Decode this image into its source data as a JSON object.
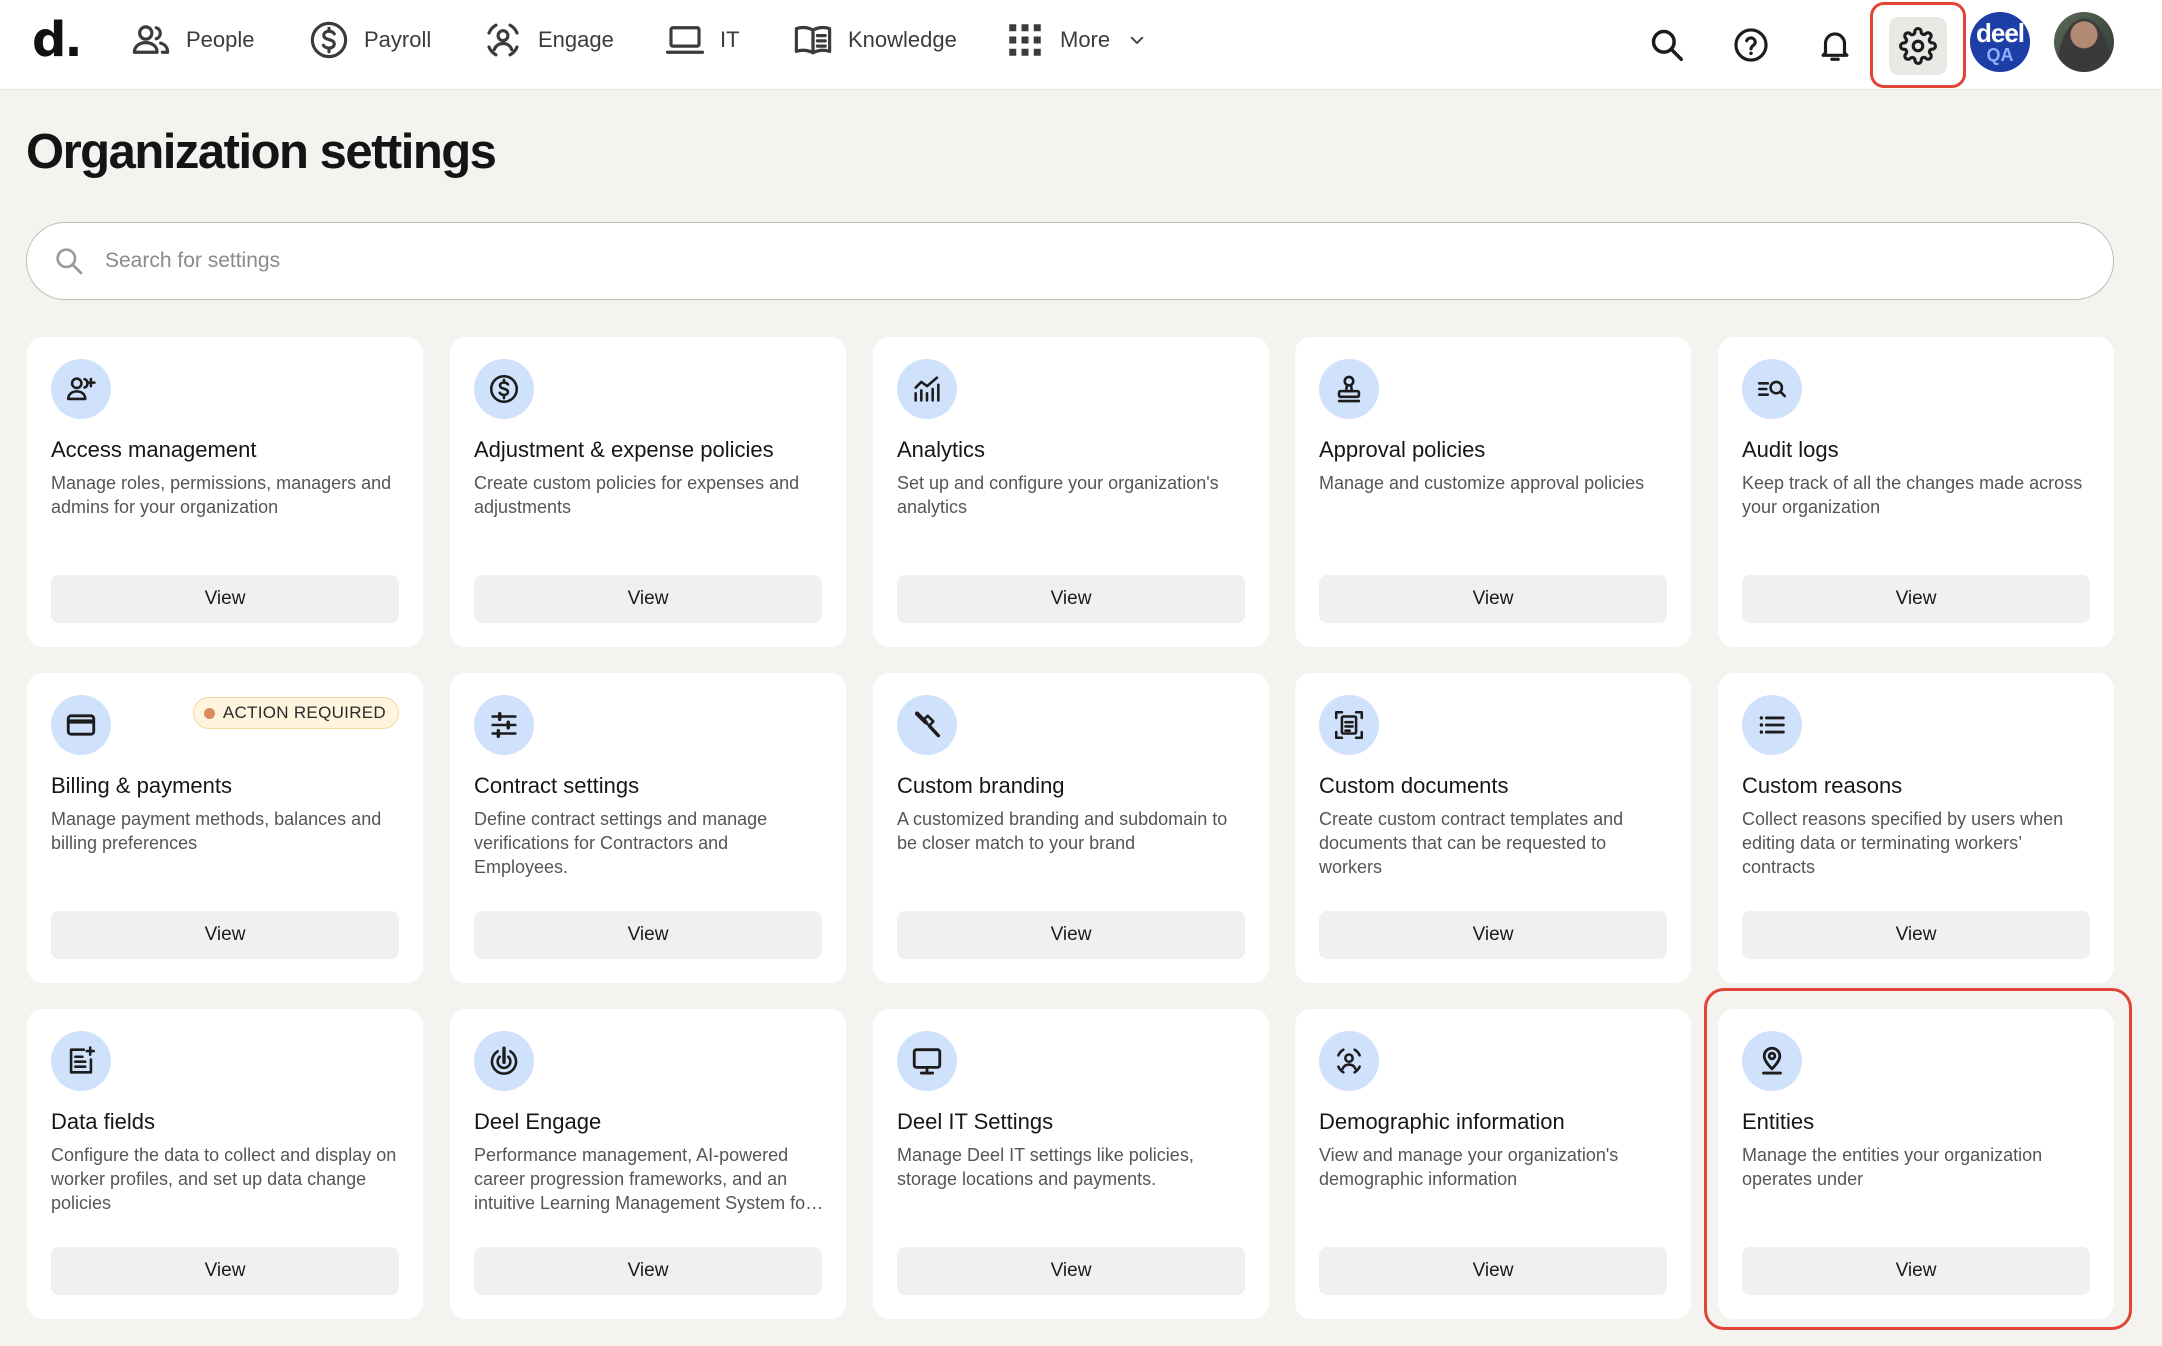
{
  "nav": {
    "logo": "d.",
    "items": [
      {
        "label": "People",
        "icon": "people-icon"
      },
      {
        "label": "Payroll",
        "icon": "dollar-circle-icon"
      },
      {
        "label": "Engage",
        "icon": "engage-icon"
      },
      {
        "label": "IT",
        "icon": "laptop-icon"
      },
      {
        "label": "Knowledge",
        "icon": "book-icon"
      },
      {
        "label": "More",
        "icon": "grid-icon"
      }
    ],
    "org_avatar": {
      "line1": "deel",
      "line2": "QA"
    }
  },
  "page": {
    "title": "Organization settings",
    "search_placeholder": "Search for settings"
  },
  "cards": [
    {
      "title": "Access management",
      "desc": "Manage roles, permissions, managers and admins for your organization",
      "button": "View",
      "icon": "user-add-icon"
    },
    {
      "title": "Adjustment & expense policies",
      "desc": "Create custom policies for expenses and adjustments",
      "button": "View",
      "icon": "dollar-circle-icon"
    },
    {
      "title": "Analytics",
      "desc": "Set up and configure your organization's analytics",
      "button": "View",
      "icon": "analytics-icon"
    },
    {
      "title": "Approval policies",
      "desc": "Manage and customize approval policies",
      "button": "View",
      "icon": "stamp-icon"
    },
    {
      "title": "Audit logs",
      "desc": "Keep track of all the changes made across your organization",
      "button": "View",
      "icon": "log-search-icon"
    },
    {
      "title": "Billing & payments",
      "desc": "Manage payment methods, balances and billing preferences",
      "button": "View",
      "icon": "credit-card-icon",
      "badge": "ACTION REQUIRED"
    },
    {
      "title": "Contract settings",
      "desc": "Define contract settings and manage verifications for Contractors and Employees.",
      "button": "View",
      "icon": "sliders-icon"
    },
    {
      "title": "Custom branding",
      "desc": "A customized branding and subdomain to be closer match to your brand",
      "button": "View",
      "icon": "brush-icon"
    },
    {
      "title": "Custom documents",
      "desc": "Create custom contract templates and documents that can be requested to workers",
      "button": "View",
      "icon": "document-scan-icon"
    },
    {
      "title": "Custom reasons",
      "desc": "Collect reasons specified by users when editing data or terminating workers’ contracts",
      "button": "View",
      "icon": "list-icon"
    },
    {
      "title": "Data fields",
      "desc": "Configure the data to collect and display on worker profiles, and set up data change policies",
      "button": "View",
      "icon": "form-add-icon"
    },
    {
      "title": "Deel Engage",
      "desc": "Performance management, AI-powered career progression frameworks, and an intuitive Learning Management System for employee development",
      "button": "View",
      "icon": "target-icon"
    },
    {
      "title": "Deel IT Settings",
      "desc": "Manage Deel IT settings like policies, storage locations and payments.",
      "button": "View",
      "icon": "monitor-icon"
    },
    {
      "title": "Demographic information",
      "desc": "View and manage your organization's demographic information",
      "button": "View",
      "icon": "person-scan-icon"
    },
    {
      "title": "Entities",
      "desc": "Manage the entities your organization operates under",
      "button": "View",
      "icon": "location-pin-icon"
    }
  ]
}
